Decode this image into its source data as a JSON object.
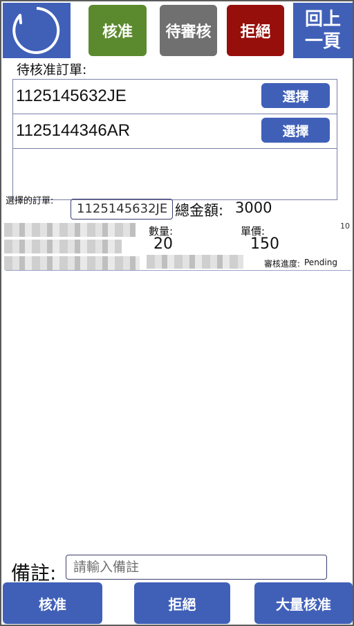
{
  "header": {
    "refresh_icon": "refresh-icon",
    "approve_label": "核准",
    "pending_label": "待審核",
    "reject_label": "拒絕",
    "back_line1": "回上",
    "back_line2": "一頁",
    "colors": {
      "approve": "#5b8a2e",
      "pending": "#707070",
      "reject": "#960f0a",
      "primary": "#4060b8"
    }
  },
  "orders_list": {
    "title": "待核准訂單:",
    "items": [
      {
        "id": "1125145632JE",
        "select_label": "選擇"
      },
      {
        "id": "1125144346AR",
        "select_label": "選擇"
      }
    ]
  },
  "detail": {
    "selected_label": "選擇的訂單:",
    "selected_value": "1125145632JE",
    "total_label": "總金額:",
    "total_value": "3000",
    "corner_number": "10",
    "quantity_label": "數量:",
    "quantity_value": "20",
    "unit_price_label": "單價:",
    "unit_price_value": "150",
    "status_label": "審核進度:",
    "status_value": "Pending"
  },
  "remark": {
    "label": "備註:",
    "placeholder": "請輸入備註",
    "value": ""
  },
  "footer": {
    "approve_label": "核准",
    "reject_label": "拒絕",
    "bulk_approve_label": "大量核准"
  }
}
